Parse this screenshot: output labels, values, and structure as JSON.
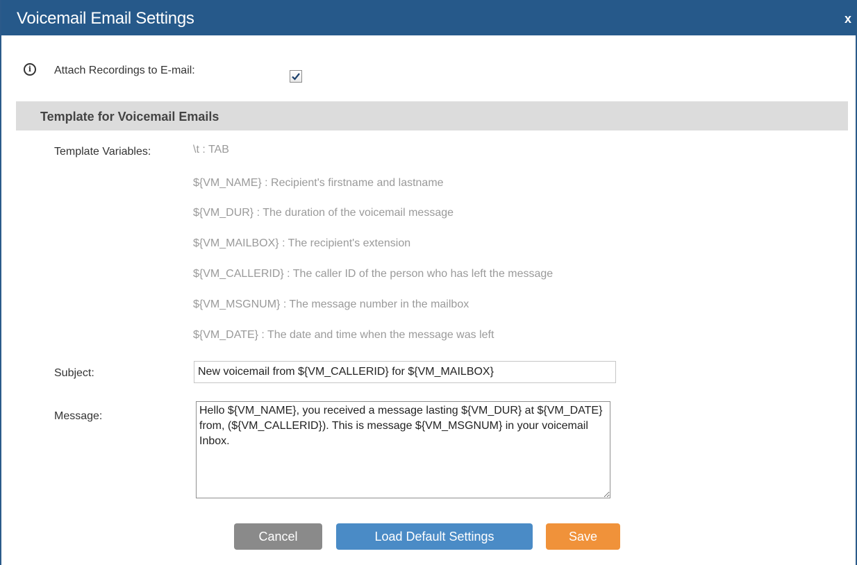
{
  "dialog": {
    "title": "Voicemail Email Settings",
    "close_label": "x"
  },
  "attach": {
    "label": "Attach Recordings to E-mail:",
    "checked": true
  },
  "section": {
    "title": "Template for Voicemail Emails"
  },
  "template": {
    "label": "Template Variables:",
    "variables": [
      "\\t : TAB",
      "${VM_NAME} : Recipient's firstname and lastname",
      "${VM_DUR} : The duration of the voicemail message",
      "${VM_MAILBOX} : The recipient's extension",
      "${VM_CALLERID} : The caller ID of the person who has left the message",
      "${VM_MSGNUM} : The message number in the mailbox",
      "${VM_DATE} : The date and time when the message was left"
    ]
  },
  "subject": {
    "label": "Subject:",
    "value": "New voicemail from ${VM_CALLERID} for ${VM_MAILBOX}"
  },
  "message": {
    "label": "Message:",
    "value": "Hello ${VM_NAME}, you received a message lasting ${VM_DUR} at ${VM_DATE} from, (${VM_CALLERID}). This is message ${VM_MSGNUM} in your voicemail Inbox."
  },
  "buttons": {
    "cancel": "Cancel",
    "load_default": "Load Default Settings",
    "save": "Save"
  },
  "colors": {
    "titlebar": "#26598a",
    "section_bg": "#dcdcdc",
    "cancel": "#8a8a8a",
    "load_default": "#4a8bc6",
    "save": "#f0923a"
  }
}
